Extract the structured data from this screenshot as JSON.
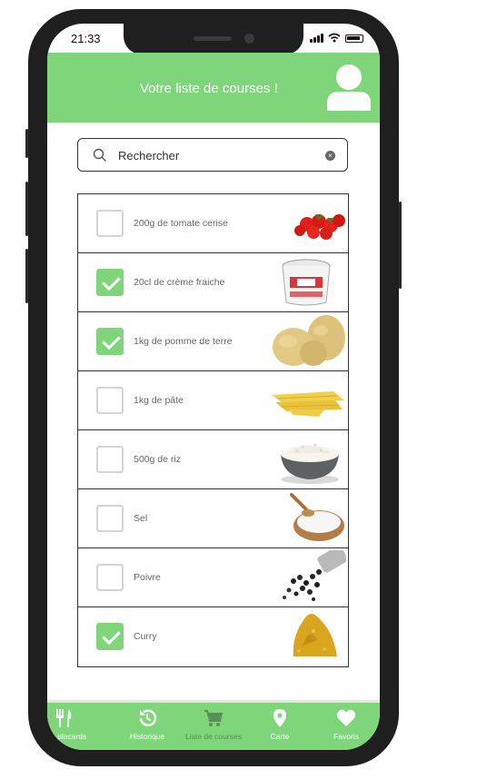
{
  "status": {
    "time": "21:33"
  },
  "header": {
    "title": "Votre liste de courses !",
    "avatar_icon": "user-icon"
  },
  "search": {
    "placeholder": "Rechercher"
  },
  "list": {
    "items": [
      {
        "label": "200g de tomate cerise",
        "checked": false,
        "image": "cherry-tomatoes"
      },
      {
        "label": "20cl de crème fraiche",
        "checked": true,
        "image": "creme-fraiche-pot"
      },
      {
        "label": "1kg de pomme de terre",
        "checked": true,
        "image": "potatoes"
      },
      {
        "label": "1kg de pâte",
        "checked": false,
        "image": "pasta"
      },
      {
        "label": "500g de riz",
        "checked": false,
        "image": "rice-bowl"
      },
      {
        "label": "Sel",
        "checked": false,
        "image": "salt-bowl"
      },
      {
        "label": "Poivre",
        "checked": false,
        "image": "peppercorns"
      },
      {
        "label": "Curry",
        "checked": true,
        "image": "curry-powder"
      }
    ]
  },
  "bottom_nav": {
    "items": [
      {
        "label": "Mes placards",
        "icon": "utensils-icon"
      },
      {
        "label": "Historique",
        "icon": "history-icon"
      },
      {
        "label": "Liste de courses",
        "icon": "cart-icon",
        "active": true
      },
      {
        "label": "Carte",
        "icon": "map-pin-icon"
      },
      {
        "label": "Favoris",
        "icon": "heart-icon"
      }
    ]
  },
  "colors": {
    "accent": "#7fd57a",
    "active_nav": "#5a8f57",
    "checkbox_border": "#d4d4d4"
  }
}
